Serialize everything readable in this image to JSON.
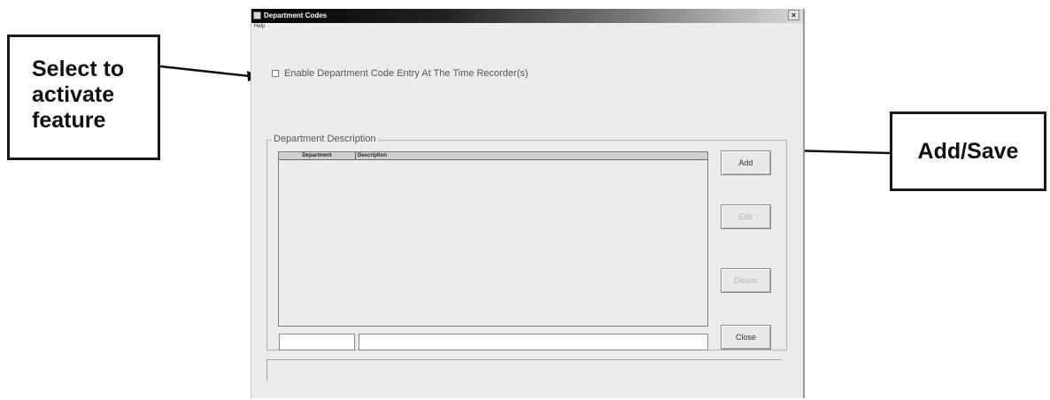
{
  "callouts": {
    "left_line1": "Select to",
    "left_line2": "activate",
    "left_line3": "feature",
    "right": "Add/Save"
  },
  "window": {
    "title": "Department Codes",
    "close_glyph": "×",
    "menu": {
      "help": "Help"
    },
    "enable_checkbox": {
      "label": "Enable Department Code Entry At The Time Recorder(s)",
      "checked": false
    },
    "group": {
      "label": "Department Description",
      "columns": [
        "Department",
        "Description"
      ],
      "rows": [],
      "inputs": {
        "department": "",
        "description": ""
      }
    },
    "buttons": {
      "add": "Add",
      "edit": "Edit",
      "delete": "Delete",
      "close": "Close"
    }
  },
  "colors": {
    "window_bg": "#ececec",
    "disabled_text": "#b8b8b8"
  },
  "icons": [
    "window-icon",
    "close-icon",
    "arrow-right-icon",
    "arrow-left-icon"
  ]
}
